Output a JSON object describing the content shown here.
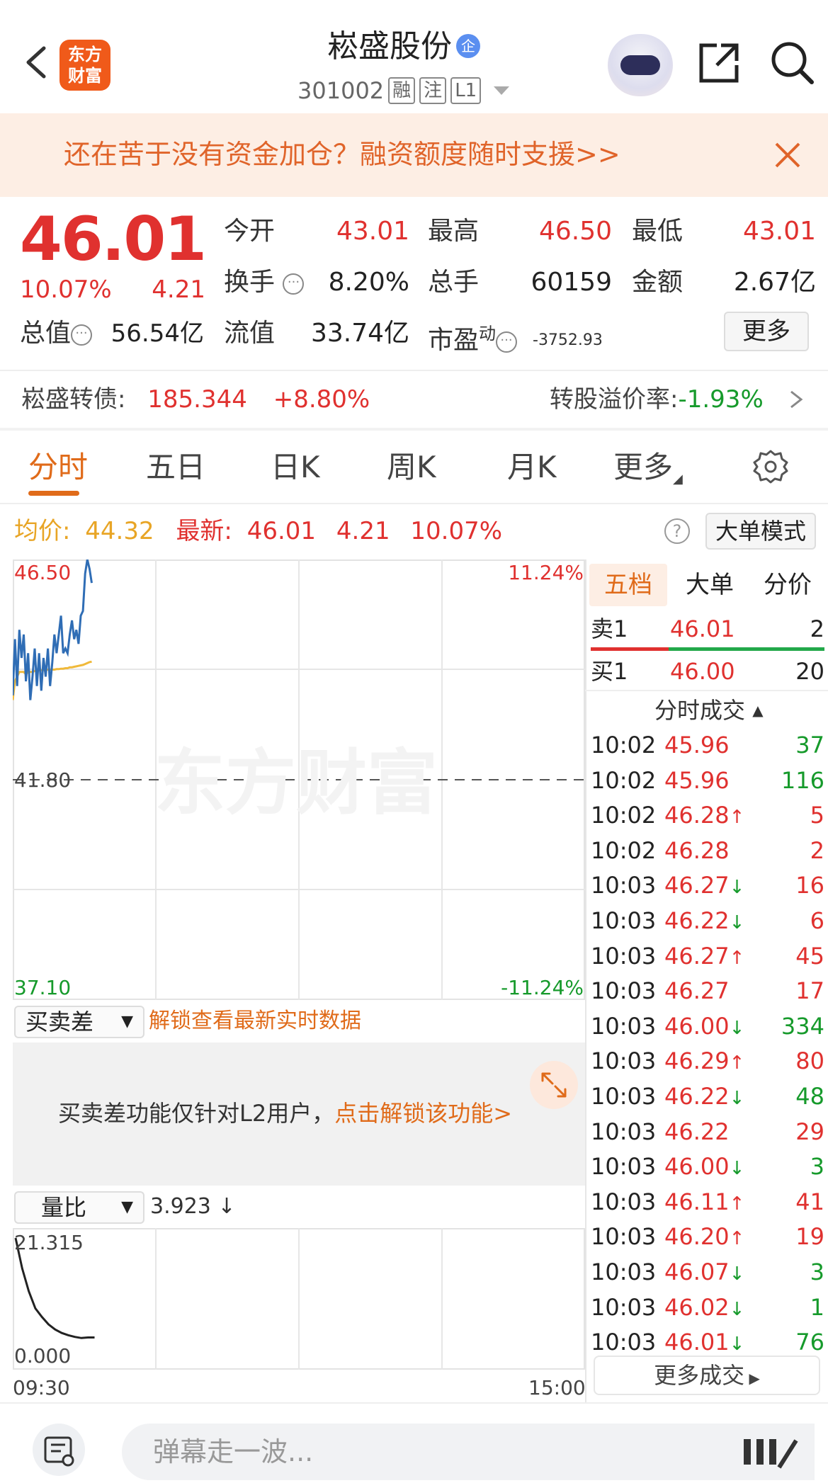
{
  "header": {
    "logo_text_line1": "东方",
    "logo_text_line2": "财富",
    "stock_name": "崧盛股份",
    "qi_badge": "企",
    "stock_code": "301002",
    "tags": [
      "融",
      "注",
      "L1"
    ]
  },
  "banner": {
    "text": "还在苦于没有资金加仓？融资额度随时支援>>"
  },
  "quote": {
    "price": "46.01",
    "change_pct": "10.07%",
    "change_amt": "4.21",
    "total_value_label": "总值",
    "total_value": "56.54亿",
    "stats": [
      {
        "label": "今开",
        "value": "43.01"
      },
      {
        "label": "最高",
        "value": "46.50"
      },
      {
        "label": "最低",
        "value": "43.01"
      },
      {
        "label": "换手",
        "value": "8.20%"
      },
      {
        "label": "总手",
        "value": "60159"
      },
      {
        "label": "金额",
        "value": "2.67亿"
      },
      {
        "label": "流值",
        "value": "33.74亿"
      },
      {
        "label": "市盈",
        "sup": "动",
        "value": "-3752.93"
      }
    ],
    "more_label": "更多"
  },
  "convertible": {
    "label": "崧盛转债:",
    "price": "185.344",
    "change": "+8.80%",
    "premium_label": "转股溢价率:",
    "premium_value": "-1.93%"
  },
  "tabs": [
    "分时",
    "五日",
    "日K",
    "周K",
    "月K",
    "更多"
  ],
  "info": {
    "avg_label": "均价:",
    "avg_value": "44.32",
    "latest_label": "最新:",
    "latest_value": "46.01",
    "latest_change": "4.21",
    "latest_pct": "10.07%",
    "help": "?",
    "big_mode": "大单模式"
  },
  "chart_data": {
    "type": "line",
    "y_top_label": "46.50",
    "y_mid_label": "41.80",
    "y_bottom_label": "37.10",
    "pct_top_label": "11.24%",
    "pct_bottom_label": "-11.24%",
    "ylim": [
      37.1,
      46.5
    ],
    "prev_close": 41.8,
    "watermark": "东方财富",
    "series": [
      {
        "values": [
          43.6,
          44.8,
          43.8,
          45.0,
          44.4,
          44.9,
          43.9,
          44.5,
          43.5,
          44.0,
          44.6,
          43.8,
          44.5,
          43.7,
          44.4,
          44.0,
          44.6,
          43.8,
          44.3,
          44.9,
          44.5,
          44.9,
          45.3,
          44.5,
          44.6,
          44.5,
          44.9,
          45.2,
          44.8,
          45.0,
          44.7,
          45.3,
          45.4,
          46.2,
          46.5,
          46.3,
          46.0
        ]
      },
      {
        "values": [
          43.5,
          43.9,
          44.0,
          44.1,
          44.1,
          44.1,
          44.05,
          44.1,
          44.1,
          44.1,
          44.12,
          44.12,
          44.14,
          44.14,
          44.14,
          44.14,
          44.15,
          44.15,
          44.15,
          44.15,
          44.16,
          44.16,
          44.17,
          44.17,
          44.18,
          44.18,
          44.2,
          44.2,
          44.21,
          44.22,
          44.23,
          44.24,
          44.25,
          44.27,
          44.29,
          44.31,
          44.32
        ]
      }
    ]
  },
  "level2": {
    "dropdown": "买卖差",
    "unlock_tip": "解锁查看最新实时数据",
    "panel_text": "买卖差功能仅针对L2用户，",
    "panel_link": "点击解锁该功能>"
  },
  "volume": {
    "dropdown": "量比",
    "value": "3.923 ↓",
    "top_label": "21.315",
    "bottom_label": "0.000",
    "values": [
      21.3,
      16,
      12,
      9,
      7.5,
      6.2,
      5.3,
      4.7,
      4.3,
      4.0,
      3.8,
      3.9,
      3.9
    ]
  },
  "time_axis": {
    "start": "09:30",
    "end": "15:00"
  },
  "right_panel": {
    "tabs": [
      "五档",
      "大单",
      "分价"
    ],
    "sell1": {
      "label": "卖1",
      "price": "46.01",
      "vol": "2"
    },
    "buy1": {
      "label": "买1",
      "price": "46.00",
      "vol": "20"
    },
    "ticks_title": "分时成交",
    "ticks": [
      {
        "time": "10:02",
        "price": "45.96",
        "dir": "",
        "vol": "37",
        "vcolor": "green"
      },
      {
        "time": "10:02",
        "price": "45.96",
        "dir": "",
        "vol": "116",
        "vcolor": "green"
      },
      {
        "time": "10:02",
        "price": "46.28",
        "dir": "↑",
        "vol": "5",
        "vcolor": "red"
      },
      {
        "time": "10:02",
        "price": "46.28",
        "dir": "",
        "vol": "2",
        "vcolor": "red"
      },
      {
        "time": "10:03",
        "price": "46.27",
        "dir": "↓",
        "vol": "16",
        "vcolor": "red"
      },
      {
        "time": "10:03",
        "price": "46.22",
        "dir": "↓",
        "vol": "6",
        "vcolor": "red"
      },
      {
        "time": "10:03",
        "price": "46.27",
        "dir": "↑",
        "vol": "45",
        "vcolor": "red"
      },
      {
        "time": "10:03",
        "price": "46.27",
        "dir": "",
        "vol": "17",
        "vcolor": "red"
      },
      {
        "time": "10:03",
        "price": "46.00",
        "dir": "↓",
        "vol": "334",
        "vcolor": "green"
      },
      {
        "time": "10:03",
        "price": "46.29",
        "dir": "↑",
        "vol": "80",
        "vcolor": "red"
      },
      {
        "time": "10:03",
        "price": "46.22",
        "dir": "↓",
        "vol": "48",
        "vcolor": "green"
      },
      {
        "time": "10:03",
        "price": "46.22",
        "dir": "",
        "vol": "29",
        "vcolor": "red"
      },
      {
        "time": "10:03",
        "price": "46.00",
        "dir": "↓",
        "vol": "3",
        "vcolor": "green"
      },
      {
        "time": "10:03",
        "price": "46.11",
        "dir": "↑",
        "vol": "41",
        "vcolor": "red"
      },
      {
        "time": "10:03",
        "price": "46.20",
        "dir": "↑",
        "vol": "19",
        "vcolor": "red"
      },
      {
        "time": "10:03",
        "price": "46.07",
        "dir": "↓",
        "vol": "3",
        "vcolor": "green"
      },
      {
        "time": "10:03",
        "price": "46.02",
        "dir": "↓",
        "vol": "1",
        "vcolor": "green"
      },
      {
        "time": "10:03",
        "price": "46.01",
        "dir": "↓",
        "vol": "76",
        "vcolor": "green"
      }
    ],
    "more_trades": "更多成交"
  },
  "bottom_bar": {
    "danmu_placeholder": "弹幕走一波..."
  },
  "colors": {
    "up": "#e0312f",
    "down": "#169a2b",
    "accent": "#e06b1a",
    "price_line": "#2f6db5",
    "avg_line": "#f0b93a"
  }
}
